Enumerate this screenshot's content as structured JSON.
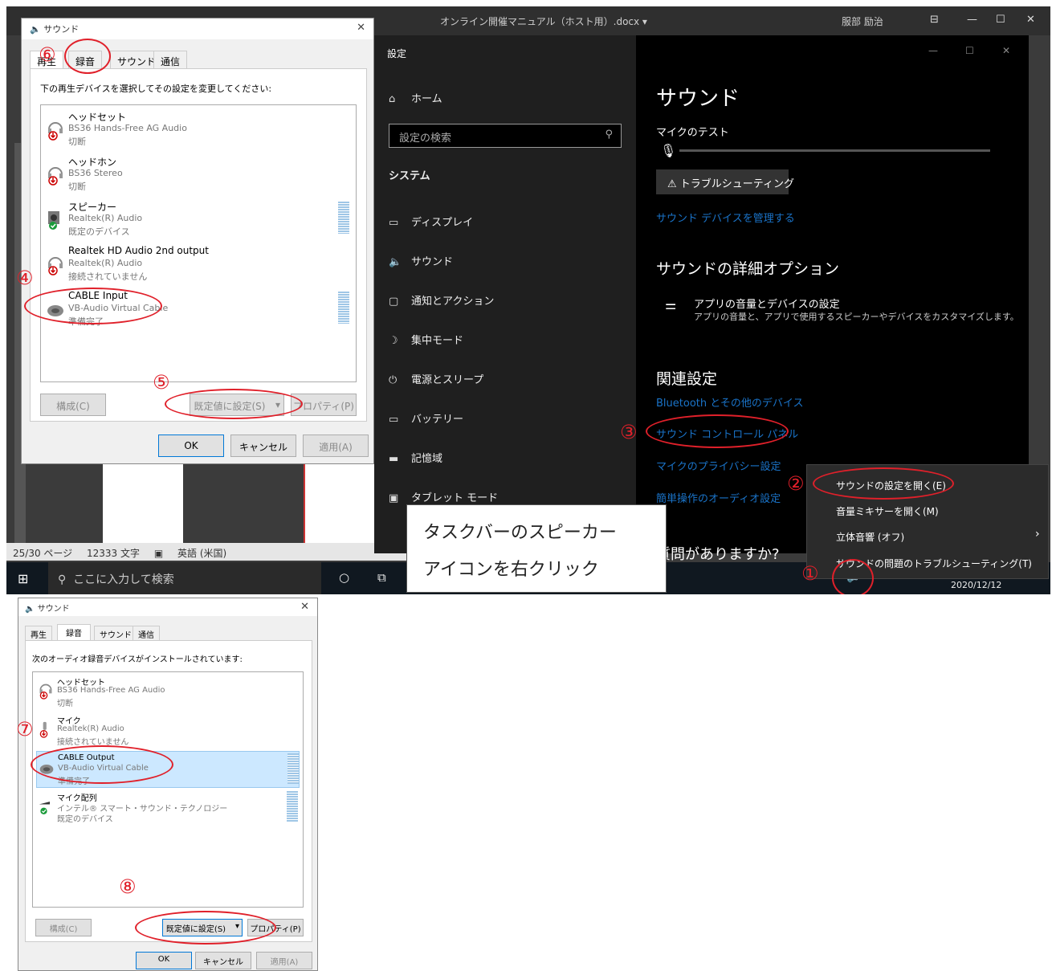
{
  "word": {
    "title": "オンライン開催マニュアル（ホスト用）.docx ▾",
    "user": "服部 励治",
    "status_pages": "25/30 ページ",
    "status_chars": "12333 文字",
    "status_lang": "英語 (米国)"
  },
  "taskbar": {
    "search_placeholder": "ここに入力して検索",
    "date": "2020/12/12"
  },
  "dialog1": {
    "title": "サウンド",
    "tabs": [
      "再生",
      "録音",
      "サウンド",
      "通信"
    ],
    "instruction": "下の再生デバイスを選択してその設定を変更してください:",
    "devices": [
      {
        "name": "ヘッドセット",
        "desc": "BS36 Hands-Free AG Audio",
        "status": "切断"
      },
      {
        "name": "ヘッドホン",
        "desc": "BS36 Stereo",
        "status": "切断"
      },
      {
        "name": "スピーカー",
        "desc": "Realtek(R) Audio",
        "status": "既定のデバイス"
      },
      {
        "name": "Realtek HD Audio 2nd output",
        "desc": "Realtek(R) Audio",
        "status": "接続されていません"
      },
      {
        "name": "CABLE Input",
        "desc": "VB-Audio Virtual Cable",
        "status": "準備完了"
      }
    ],
    "btn_config": "構成(C)",
    "btn_default": "既定値に設定(S)",
    "btn_props": "プロパティ(P)",
    "btn_ok": "OK",
    "btn_cancel": "キャンセル",
    "btn_apply": "適用(A)"
  },
  "settings": {
    "title": "設定",
    "home": "ホーム",
    "search_placeholder": "設定の検索",
    "section": "システム",
    "nav": [
      "ディスプレイ",
      "サウンド",
      "通知とアクション",
      "集中モード",
      "電源とスリープ",
      "バッテリー",
      "記憶域",
      "タブレット モード"
    ],
    "page_title": "サウンド",
    "mic_test": "マイクのテスト",
    "troubleshoot": "トラブルシューティング",
    "manage_devices": "サウンド デバイスを管理する",
    "advanced_title": "サウンドの詳細オプション",
    "app_volume_title": "アプリの音量とデバイスの設定",
    "app_volume_desc": "アプリの音量と、アプリで使用するスピーカーやデバイスをカスタマイズします。",
    "related_title": "関連設定",
    "link_bluetooth": "Bluetooth とその他のデバイス",
    "link_control_panel": "サウンド コントロール パネル",
    "link_mic_privacy": "マイクのプライバシー設定",
    "link_ease": "簡単操作のオーディオ設定",
    "question": "質問がありますか?"
  },
  "context_menu": {
    "items": [
      "サウンドの設定を開く(E)",
      "音量ミキサーを開く(M)",
      "立体音響 (オフ)",
      "サウンドの問題のトラブルシューティング(T)"
    ]
  },
  "callout": {
    "line1": "タスクバーのスピーカー",
    "line2": "アイコンを右クリック"
  },
  "dialog2": {
    "title": "サウンド",
    "tabs": [
      "再生",
      "録音",
      "サウンド",
      "通信"
    ],
    "instruction": "次のオーディオ録音デバイスがインストールされています:",
    "devices": [
      {
        "name": "ヘッドセット",
        "desc": "BS36 Hands-Free AG Audio",
        "status": "切断"
      },
      {
        "name": "マイク",
        "desc": "Realtek(R) Audio",
        "status": "接続されていません"
      },
      {
        "name": "CABLE Output",
        "desc": "VB-Audio Virtual Cable",
        "status": "準備完了"
      },
      {
        "name": "マイク配列",
        "desc": "インテル® スマート・サウンド・テクノロジー",
        "status": "既定のデバイス"
      }
    ],
    "btn_config": "構成(C)",
    "btn_default": "既定値に設定(S)",
    "btn_props": "プロパティ(P)",
    "btn_ok": "OK",
    "btn_cancel": "キャンセル",
    "btn_apply": "適用(A)"
  },
  "annotations": [
    "①",
    "②",
    "③",
    "④",
    "⑤",
    "⑥",
    "⑦",
    "⑧"
  ],
  "colors": {
    "annotation": "#e0202a",
    "link": "#1a73c8",
    "selection": "#cce8ff"
  }
}
